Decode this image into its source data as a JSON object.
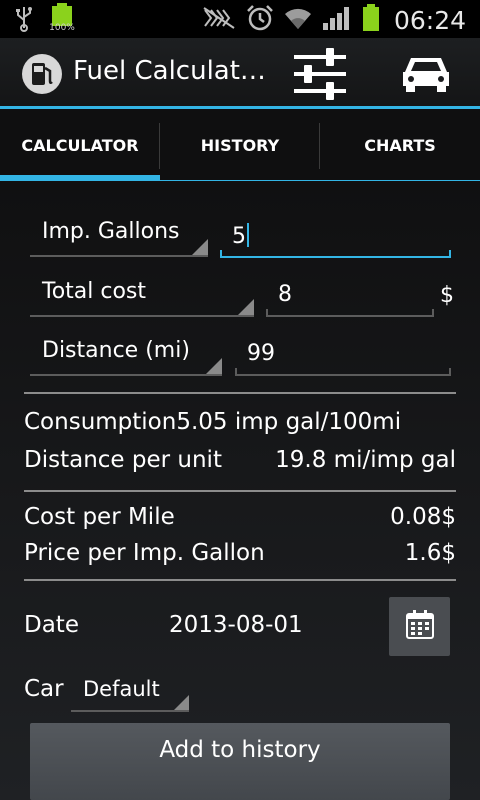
{
  "status_bar": {
    "battery_small_percent": "100%",
    "time": "06:24",
    "icons": [
      "usb-icon",
      "battery-icon",
      "mute-icon",
      "alarm-icon",
      "wifi-icon",
      "signal-icon",
      "battery-icon"
    ]
  },
  "action_bar": {
    "title": "Fuel Calculat…",
    "icons": [
      "fuel-pump-icon",
      "settings-sliders-icon",
      "car-icon"
    ]
  },
  "tabs": [
    {
      "label": "CALCULATOR",
      "selected": true
    },
    {
      "label": "HISTORY",
      "selected": false
    },
    {
      "label": "CHARTS",
      "selected": false
    }
  ],
  "form": {
    "volume_unit": "Imp. Gallons",
    "volume_value": "5",
    "cost_mode": "Total cost",
    "cost_value": "8",
    "currency": "$",
    "distance_unit": "Distance (mi)",
    "distance_value": "99"
  },
  "results": {
    "consumption_label": "Consumption",
    "consumption_value": "5.05 imp gal/100mi",
    "distance_per_unit_label": "Distance per unit",
    "distance_per_unit_value": "19.8 mi/imp gal",
    "cost_per_mile_label": "Cost per Mile",
    "cost_per_mile_value": "0.08$",
    "price_per_unit_label": "Price per Imp. Gallon",
    "price_per_unit_value": "1.6$"
  },
  "date": {
    "label": "Date",
    "value": "2013-08-01"
  },
  "car": {
    "label": "Car",
    "value": "Default"
  },
  "add_button": "Add to history",
  "colors": {
    "accent": "#33b5e5",
    "battery_green": "#8bd21c",
    "background": "#1c1e21"
  }
}
